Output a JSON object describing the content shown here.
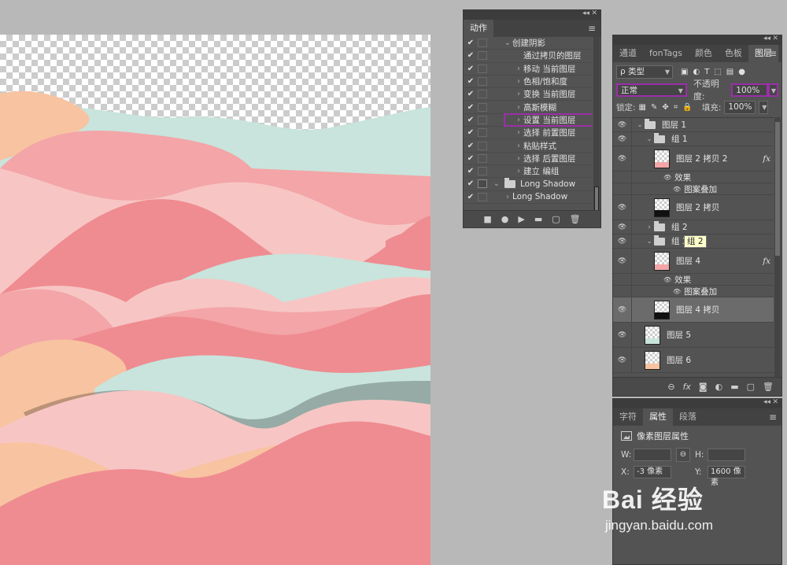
{
  "actions_panel": {
    "tab": "动作",
    "rows": [
      {
        "label": "创建阴影",
        "indent": 1,
        "caret": "v",
        "checked": true
      },
      {
        "label": "通过拷贝的图层",
        "indent": 2,
        "caret": "",
        "checked": true
      },
      {
        "label": "移动 当前图层",
        "indent": 2,
        "caret": ">",
        "checked": true
      },
      {
        "label": "色相/饱和度",
        "indent": 2,
        "caret": ">",
        "checked": true
      },
      {
        "label": "变换 当前图层",
        "indent": 2,
        "caret": ">",
        "checked": true
      },
      {
        "label": "高斯模糊",
        "indent": 2,
        "caret": ">",
        "checked": true
      },
      {
        "label": "设置 当前图层",
        "indent": 2,
        "caret": ">",
        "checked": true,
        "highlight": true
      },
      {
        "label": "选择 前置图层",
        "indent": 2,
        "caret": ">",
        "checked": true
      },
      {
        "label": "粘贴样式",
        "indent": 2,
        "caret": ">",
        "checked": true
      },
      {
        "label": "选择 后置图层",
        "indent": 2,
        "caret": ">",
        "checked": true
      },
      {
        "label": "建立 编组",
        "indent": 2,
        "caret": ">",
        "checked": true
      },
      {
        "label": "Long Shadow",
        "indent": 0,
        "caret": "v",
        "checked": true,
        "folder": true
      },
      {
        "label": "Long Shadow",
        "indent": 1,
        "caret": ">",
        "checked": true
      }
    ],
    "footer_icons": [
      "stop-icon",
      "record-icon",
      "play-icon",
      "folder-icon",
      "new-icon",
      "trash-icon"
    ]
  },
  "layers_panel": {
    "tabs": [
      "通道",
      "fonTags",
      "颜色",
      "色板",
      "图层"
    ],
    "active_tab": "图层",
    "filter_select": "ρ 类型",
    "blend_mode": "正常",
    "opacity_label": "不透明度:",
    "opacity_value": "100%",
    "lock_label": "锁定:",
    "fill_label": "填充:",
    "fill_value": "100%",
    "tooltip": "组 2",
    "layers": [
      {
        "name": "图层 1",
        "kind": "group-open",
        "level": 0,
        "eye": true,
        "h": 18
      },
      {
        "name": "组 1",
        "kind": "group-open",
        "level": 1,
        "eye": true,
        "h": 18
      },
      {
        "name": "图层 2 拷贝 2",
        "kind": "layer",
        "level": 2,
        "eye": true,
        "fx": true,
        "h": 32,
        "thumb": "pink"
      },
      {
        "name": "效果",
        "kind": "effect",
        "level": 3,
        "eye": false,
        "h": 15
      },
      {
        "name": "图案叠加",
        "kind": "effect-item",
        "level": 4,
        "eye": false,
        "h": 15
      },
      {
        "name": "图层 2 拷贝",
        "kind": "layer",
        "level": 2,
        "eye": true,
        "h": 32,
        "thumb": "black"
      },
      {
        "name": "组 2",
        "kind": "group-closed",
        "level": 1,
        "eye": true,
        "h": 18
      },
      {
        "name": "组 3",
        "kind": "group-open",
        "level": 1,
        "eye": true,
        "h": 18,
        "tooltip": true
      },
      {
        "name": "图层 4",
        "kind": "layer",
        "level": 2,
        "eye": true,
        "fx": true,
        "h": 32,
        "thumb": "pink"
      },
      {
        "name": "效果",
        "kind": "effect",
        "level": 3,
        "eye": false,
        "h": 15
      },
      {
        "name": "图案叠加",
        "kind": "effect-item",
        "level": 4,
        "eye": false,
        "h": 15
      },
      {
        "name": "图层 4 拷贝",
        "kind": "layer",
        "level": 2,
        "eye": true,
        "h": 32,
        "thumb": "black",
        "selected": true
      },
      {
        "name": "图层 5",
        "kind": "layer",
        "level": 1,
        "eye": true,
        "h": 32,
        "thumb": "mint"
      },
      {
        "name": "图层 6",
        "kind": "layer",
        "level": 1,
        "eye": true,
        "h": 32,
        "thumb": "peach"
      }
    ],
    "footer_icons": [
      "link-icon",
      "fx-icon",
      "mask-icon",
      "adjustment-icon",
      "folder-icon",
      "new-layer-icon",
      "trash-icon"
    ]
  },
  "properties_panel": {
    "tabs": [
      "字符",
      "属性",
      "段落"
    ],
    "active_tab": "属性",
    "title": "像素图层属性",
    "w_label": "W:",
    "h_label": "H:",
    "w_value": "",
    "h_value": "",
    "x_label": "X:",
    "y_label": "Y:",
    "x_value": "-3 像素",
    "y_value": "1600 像素"
  },
  "watermark": {
    "logo": "Bai 经验",
    "url": "jingyan.baidu.com"
  },
  "colors": {
    "pink_dark": "#ef8c91",
    "pink_mid": "#f3a5a7",
    "pink_light": "#f7c6c4",
    "mint": "#c8e4dc",
    "peach": "#f8c3a1",
    "highlight_border": "#9b2fa8"
  }
}
